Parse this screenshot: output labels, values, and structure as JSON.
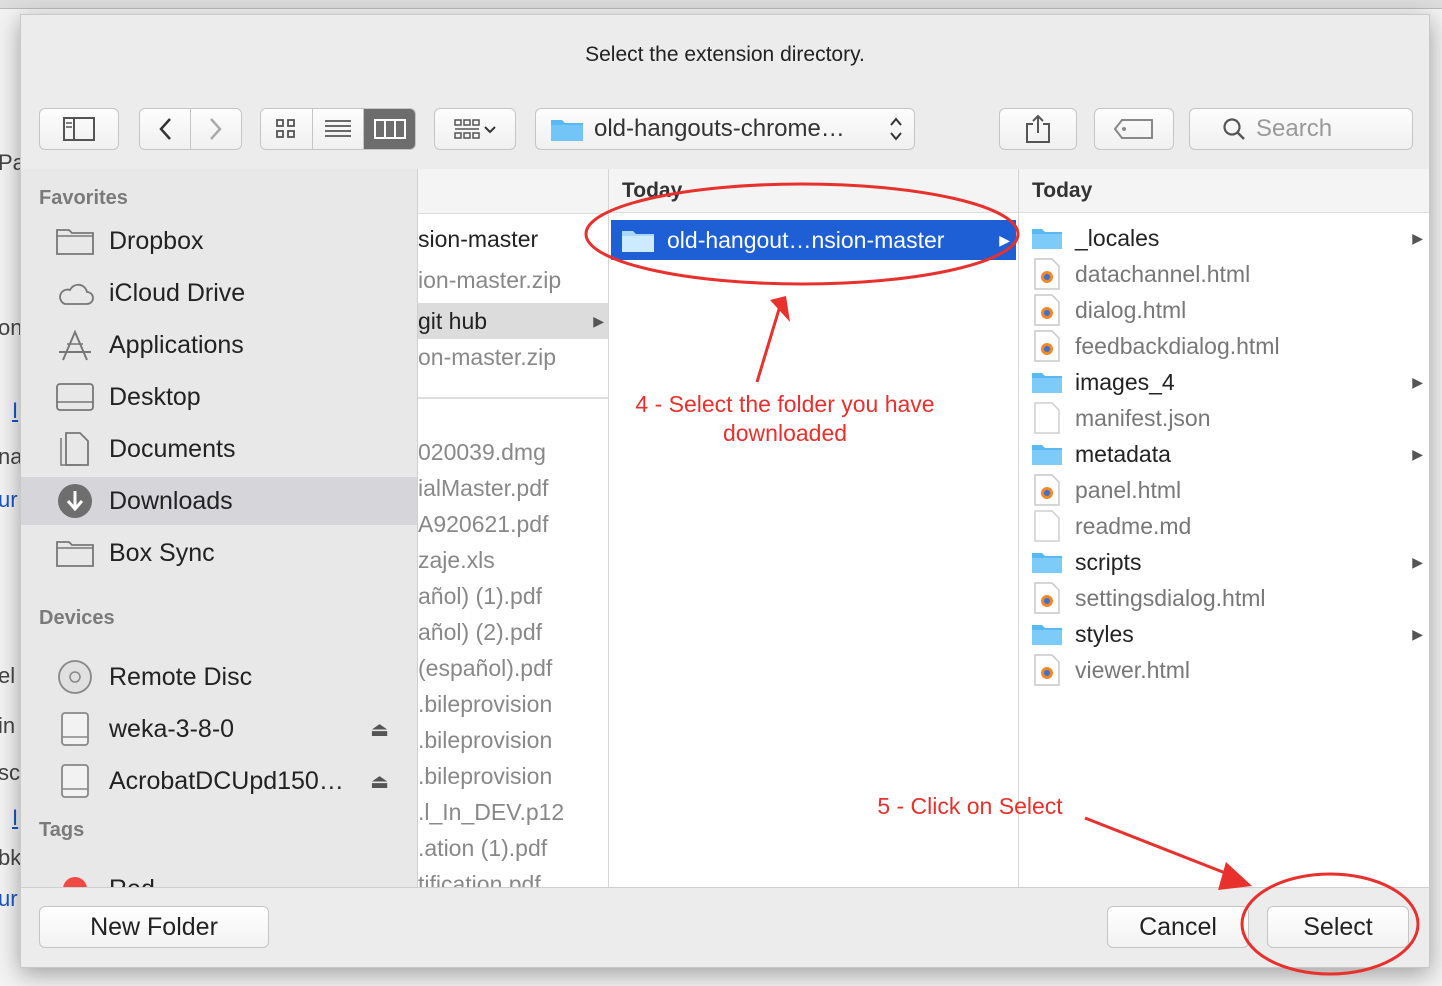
{
  "dialog": {
    "title": "Select the extension directory.",
    "path_popup": "old-hangouts-chrome…",
    "search_placeholder": "Search"
  },
  "background_fragments": [
    "Pa",
    "on",
    "I",
    "na",
    "ur",
    "el",
    "in",
    "sc",
    "I",
    "bk",
    "ur"
  ],
  "sidebar": {
    "favorites_label": "Favorites",
    "favorites": [
      {
        "label": "Dropbox",
        "icon": "folder-icon"
      },
      {
        "label": "iCloud Drive",
        "icon": "cloud-icon"
      },
      {
        "label": "Applications",
        "icon": "applications-icon"
      },
      {
        "label": "Desktop",
        "icon": "desktop-icon"
      },
      {
        "label": "Documents",
        "icon": "documents-icon"
      },
      {
        "label": "Downloads",
        "icon": "downloads-icon",
        "selected": true
      },
      {
        "label": "Box Sync",
        "icon": "folder-icon"
      }
    ],
    "devices_label": "Devices",
    "devices": [
      {
        "label": "Remote Disc",
        "icon": "disc-icon"
      },
      {
        "label": "weka-3-8-0",
        "icon": "drive-icon",
        "eject": true
      },
      {
        "label": "AcrobatDCUpd150…",
        "icon": "drive-icon",
        "eject": true
      }
    ],
    "tags_label": "Tags",
    "tags": [
      {
        "label": "Red",
        "color": "#f04a45"
      }
    ]
  },
  "column1": {
    "items": [
      {
        "label": "sion-master",
        "dark": true
      },
      {
        "label": "ion-master.zip"
      },
      {
        "label": "git hub",
        "dark": true,
        "highlight": true,
        "arrow": true
      },
      {
        "label": "on-master.zip"
      },
      {
        "label": "020039.dmg"
      },
      {
        "label": "ialMaster.pdf"
      },
      {
        "label": "A920621.pdf"
      },
      {
        "label": "zaje.xls"
      },
      {
        "label": "añol) (1).pdf"
      },
      {
        "label": "añol) (2).pdf"
      },
      {
        "label": "(español).pdf"
      },
      {
        "label": ".bileprovision"
      },
      {
        "label": ".bileprovision"
      },
      {
        "label": ".bileprovision"
      },
      {
        "label": ".l_In_DEV.p12"
      },
      {
        "label": ".ation (1).pdf"
      },
      {
        "label": "tification.pdf"
      }
    ]
  },
  "column2": {
    "header": "Today",
    "selected_item": "old-hangout…nsion-master"
  },
  "column3": {
    "header": "Today",
    "items": [
      {
        "label": "_locales",
        "type": "folder"
      },
      {
        "label": "datachannel.html",
        "type": "html"
      },
      {
        "label": "dialog.html",
        "type": "html"
      },
      {
        "label": "feedbackdialog.html",
        "type": "html"
      },
      {
        "label": "images_4",
        "type": "folder"
      },
      {
        "label": "manifest.json",
        "type": "file"
      },
      {
        "label": "metadata",
        "type": "folder"
      },
      {
        "label": "panel.html",
        "type": "html"
      },
      {
        "label": "readme.md",
        "type": "file"
      },
      {
        "label": "scripts",
        "type": "folder"
      },
      {
        "label": "settingsdialog.html",
        "type": "html"
      },
      {
        "label": "styles",
        "type": "folder"
      },
      {
        "label": "viewer.html",
        "type": "html"
      }
    ]
  },
  "bottom": {
    "new_folder": "New Folder",
    "cancel": "Cancel",
    "select": "Select"
  },
  "annotations": {
    "step4": "4 - Select the folder you have downloaded",
    "step5": "5 - Click on Select",
    "color": "#e8302c"
  }
}
